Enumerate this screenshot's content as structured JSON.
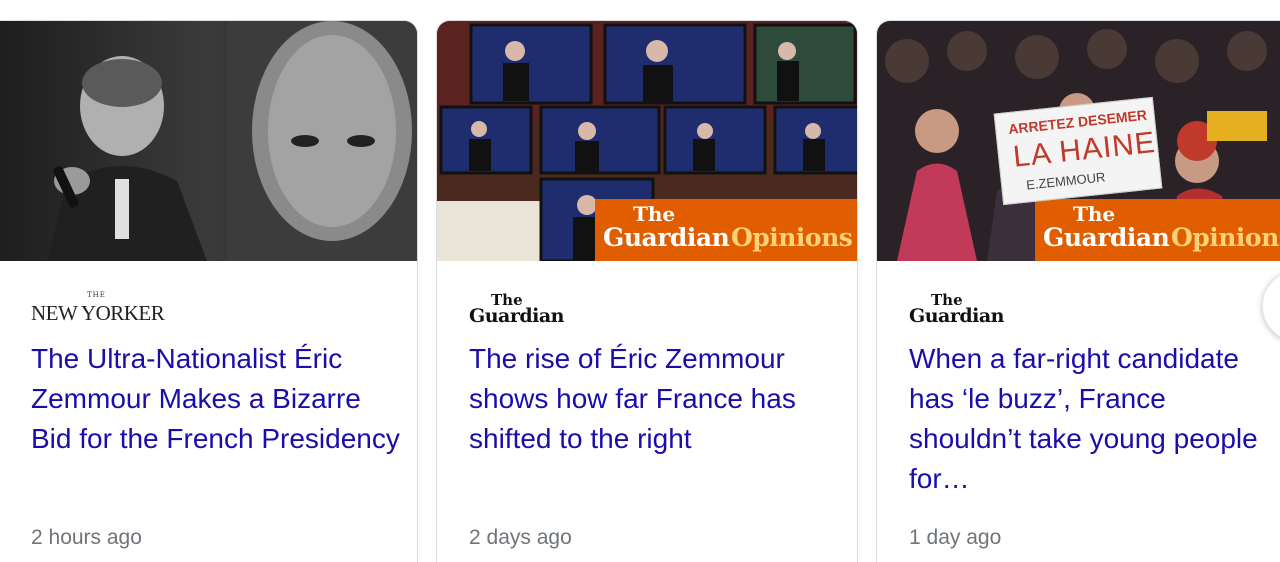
{
  "cards": [
    {
      "source": "NEW YORKER",
      "source_top": "THE",
      "headline": "The Ultra-Nationalist Éric Zemmour Makes a Bizarre Bid for the French Presidency",
      "time": "2 hours ago"
    },
    {
      "source": "Guardian",
      "source_top": "The",
      "headline": "The rise of Éric Zemmour shows how far France has shifted to the right",
      "time": "2 days ago",
      "banner": {
        "the": "The",
        "name": "Guardian",
        "section": "Opinions"
      }
    },
    {
      "source": "Guardian",
      "source_top": "The",
      "headline": "When a far-right candidate has ‘le buzz’, France shouldn’t take young people for…",
      "time": "1 day ago",
      "banner": {
        "the": "The",
        "name": "Guardian",
        "section": "Opinions"
      },
      "sign": {
        "line1": "ARRETEZ DESEMER",
        "line2": "LA HAINE",
        "line3": "E.ZEMMOUR"
      }
    }
  ],
  "colors": {
    "headline": "#1a0dab",
    "timestamp": "#70757a",
    "guardian_orange": "#e05e00",
    "card_border": "#dadce0"
  },
  "icons": {
    "next": "chevron-right-icon"
  }
}
